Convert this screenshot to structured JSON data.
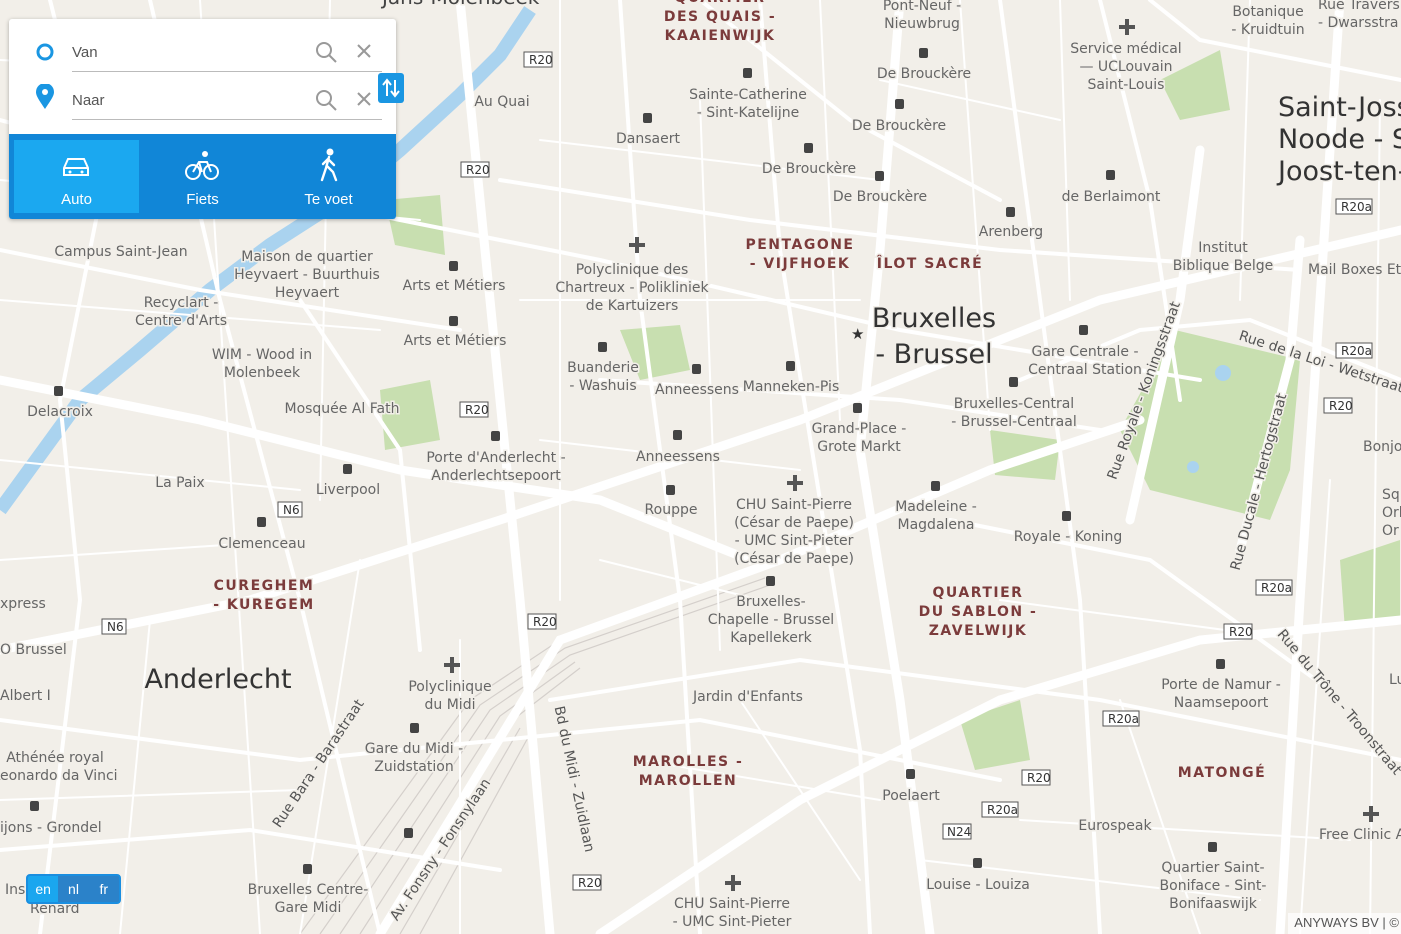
{
  "route_panel": {
    "from_placeholder": "Van",
    "to_placeholder": "Naar",
    "modes": [
      {
        "label": "Auto",
        "icon": "car-icon",
        "active": true
      },
      {
        "label": "Fiets",
        "icon": "bicycle-icon",
        "active": false
      },
      {
        "label": "Te voet",
        "icon": "pedestrian-icon",
        "active": false
      }
    ]
  },
  "languages": [
    "en",
    "nl",
    "fr"
  ],
  "selected_language": "en",
  "attribution": "ANYWAYS BV | ©",
  "colors": {
    "accent": "#1186d7",
    "accent_active": "#1ba8f0",
    "map_bg": "#f2efe9",
    "park": "#c8dfb0",
    "water": "#aad3ef",
    "road": "#ffffff",
    "district_label": "#7b3b3b"
  },
  "map": {
    "districts": [
      "Bruxelles - Brussel",
      "Anderlecht",
      "Saint-Josse-ten-Noode - Sint-Joost-ten-Node"
    ],
    "neighbourhoods": [
      "PENTAGONE - VIJFHOEK",
      "ÎLOT SACRÉ",
      "CUREGHEM - KUREGEM",
      "QUARTIER DU SABLON - ZAVELWIJK",
      "MAROLLES - MAROLLEN",
      "MATONGÉ",
      "QUARTIER DES QUAIS - KAAIENWIJK"
    ],
    "road_shields": [
      "R20",
      "R20a",
      "N6",
      "N24"
    ],
    "streets": [
      "Bd du Midi - Zuidlaan",
      "Rue Bara - Barastraat",
      "Av. Fonsny - Fonsnylaan",
      "Rue Royale - Koningsstraat",
      "Rue Ducale - Hertogstraat",
      "Rue de la Loi - Wetstraat",
      "Rue du Trône - Troonstraat"
    ],
    "stops": [
      "Sainte-Catherine - Sint-Katelijne",
      "Dansaert",
      "De Brouckère",
      "De Brouckère",
      "De Brouckère",
      "De Brouckère",
      "de Berlaimont",
      "Arenberg",
      "Au Quai",
      "Arts et Métiers",
      "Arts et Métiers",
      "Buanderie - Washuis",
      "Anneessens",
      "Anneessens",
      "Manneken-Pis",
      "Grand-Place - Grote Markt",
      "Gare Centrale - Centraal Station",
      "Bruxelles-Central - Brussel-Centraal",
      "Porte d'Anderlecht - Anderlechtsepoort",
      "Rouppe",
      "Madeleine - Magdalena",
      "Royale - Koning",
      "Liverpool",
      "Clemenceau",
      "Bruxelles-Chapelle - Brussel Kapellekerk",
      "Porte de Namur - Naamsepoort",
      "Poelaert",
      "Louise - Louiza",
      "Gare du Midi - Zuidstation",
      "Bruxelles Centre-Gare Midi",
      "Quartier Saint-Boniface - Sint-Bonifaaswijk",
      "Delacroix",
      "La Paix"
    ],
    "pois": [
      "Campus Saint-Jean",
      "Maison de quartier Heyvaert - Buurthuis Heyvaert",
      "Recyclart - Centre d'Arts",
      "WIM - Wood in Molenbeek",
      "Mosquée Al Fath",
      "Polyclinique des Chartreux - Polikliniek de Kartuizers",
      "CHU Saint-Pierre (César de Paepe) - UMC Sint-Pieter (César de Paepe)",
      "Polyclinique du Midi",
      "Jardin d'Enfants",
      "CHU Saint-Pierre - UMC Sint-Pieter",
      "Service médical — UCLouvain Saint-Louis",
      "Institut Biblique Belge",
      "Mail Boxes Etc",
      "Eurospeak",
      "Free Clinic A",
      "Athénée royal Leonardo da Vinci",
      "Pont-Neuf - Nieuwbrug",
      "Botanique - Kruidtuin"
    ],
    "edge_fragments": [
      "Jans-Molenbeek",
      "Rue Traversi - Dwarsstra",
      "Bonjo",
      "Sq Orb Or",
      "Lu",
      "xpress",
      "O Brussel",
      "Albert I",
      "ijons - Grondel",
      "Ins",
      "Renard"
    ]
  }
}
